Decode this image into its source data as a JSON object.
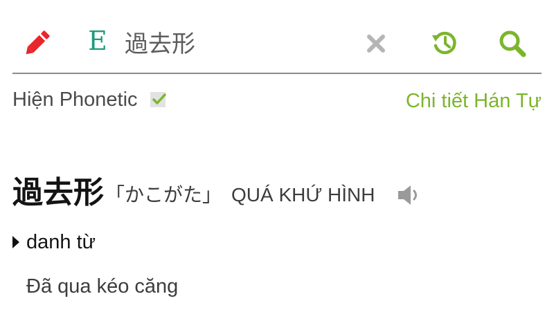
{
  "search": {
    "language_label": "E",
    "query": "過去形"
  },
  "options": {
    "phonetic_label": "Hiện Phonetic",
    "phonetic_checked": true,
    "kanji_detail_link": "Chi tiết Hán Tự"
  },
  "entry": {
    "word": "過去形",
    "reading": "「かこがた」",
    "han_viet": "QUÁ KHỨ HÌNH",
    "part_of_speech": "danh từ",
    "meaning": "Đã qua kéo căng"
  },
  "icons": {
    "edit": "pencil-icon",
    "clear": "close-icon",
    "history": "history-icon",
    "search": "search-icon",
    "speaker": "speaker-icon",
    "check": "checkmark-icon",
    "expand": "triangle-right-icon"
  },
  "colors": {
    "pencil": "#e8262b",
    "language": "#1f9a7e",
    "accent_green": "#7cb52d",
    "clear_gray": "#b5b5b5",
    "text_dark": "#141414",
    "text_gray": "#3c3c3c"
  }
}
